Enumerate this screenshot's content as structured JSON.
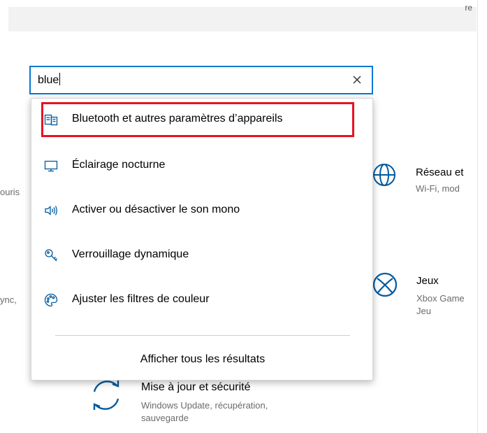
{
  "topbar": {
    "fragment": "re"
  },
  "background": {
    "left_fragments": [
      "ouris",
      "ync,"
    ],
    "network": {
      "title": "Réseau et",
      "desc": "Wi-Fi, mod"
    },
    "gaming": {
      "title": "Jeux",
      "desc1": "Xbox Game",
      "desc2": "Jeu"
    },
    "update": {
      "title": "Mise à jour et sécurité",
      "desc1": "Windows Update, récupération,",
      "desc2": "sauvegarde"
    }
  },
  "search": {
    "value": "blue",
    "clear_icon": "close-icon"
  },
  "results": [
    {
      "label": "Bluetooth et autres paramètres d’appareils",
      "icon": "bluetooth-devices-icon"
    },
    {
      "label": "Éclairage nocturne",
      "icon": "monitor-icon"
    },
    {
      "label": "Activer ou désactiver le son mono",
      "icon": "speaker-icon"
    },
    {
      "label": "Verrouillage dynamique",
      "icon": "key-icon"
    },
    {
      "label": "Ajuster les filtres de couleur",
      "icon": "palette-icon"
    }
  ],
  "show_all": "Afficher tous les résultats",
  "colors": {
    "accent": "#0078d4",
    "highlight": "#e81123",
    "icon": "#005a9e"
  }
}
